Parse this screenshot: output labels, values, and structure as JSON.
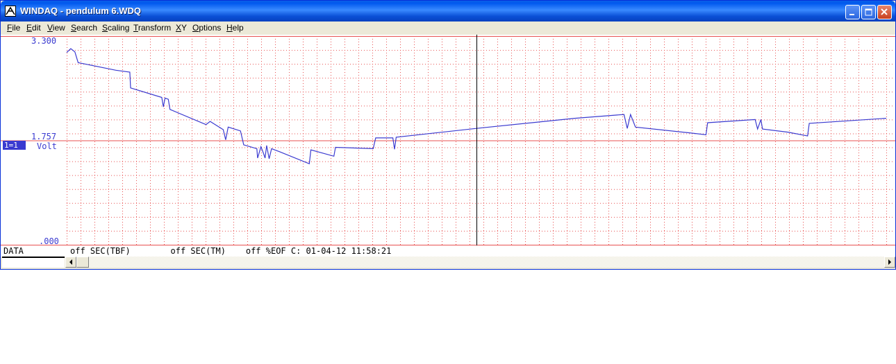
{
  "window": {
    "title": "WINDAQ - pendulum 6.WDQ"
  },
  "menu": {
    "items": [
      {
        "key": "F",
        "rest": "ile"
      },
      {
        "key": "E",
        "rest": "dit"
      },
      {
        "key": "V",
        "rest": "iew"
      },
      {
        "key": "S",
        "rest": "earch"
      },
      {
        "key": "S",
        "rest": "caling"
      },
      {
        "key": "T",
        "rest": "ransform"
      },
      {
        "key": "X",
        "rest": "Y"
      },
      {
        "key": "O",
        "rest": "ptions"
      },
      {
        "key": "H",
        "rest": "elp"
      }
    ]
  },
  "channel": {
    "badge": "1=1",
    "unit": "Volt",
    "top_value": "3.300",
    "mid_value": "1.757",
    "bottom_value": ".000"
  },
  "status": {
    "data_label": "DATA",
    "text": "off SEC(TBF)        off SEC(TM)    off %EOF C: 01-04-12 11:58:21"
  },
  "colors": {
    "grid": "#e85050",
    "trace": "#3a3ad0",
    "cursor": "#000000",
    "label": "#3a3ad0"
  },
  "chart_data": {
    "type": "line",
    "ylim": [
      0,
      3.3
    ],
    "ytick_labels": [
      "3.300",
      "1.757",
      ".000"
    ],
    "cursor_x": 0.5,
    "grid": true,
    "series": [
      {
        "points": [
          [
            0.0,
            3.04
          ],
          [
            0.005,
            3.1
          ],
          [
            0.01,
            3.05
          ],
          [
            0.014,
            2.88
          ],
          [
            0.06,
            2.76
          ],
          [
            0.077,
            2.73
          ],
          [
            0.078,
            2.48
          ],
          [
            0.116,
            2.33
          ],
          [
            0.118,
            2.18
          ],
          [
            0.12,
            2.32
          ],
          [
            0.124,
            2.3
          ],
          [
            0.126,
            2.14
          ],
          [
            0.17,
            1.9
          ],
          [
            0.175,
            1.95
          ],
          [
            0.191,
            1.82
          ],
          [
            0.194,
            1.66
          ],
          [
            0.197,
            1.86
          ],
          [
            0.212,
            1.8
          ],
          [
            0.216,
            1.58
          ],
          [
            0.232,
            1.52
          ],
          [
            0.233,
            1.37
          ],
          [
            0.237,
            1.55
          ],
          [
            0.24,
            1.45
          ],
          [
            0.242,
            1.37
          ],
          [
            0.244,
            1.57
          ],
          [
            0.247,
            1.36
          ],
          [
            0.25,
            1.52
          ],
          [
            0.26,
            1.47
          ],
          [
            0.296,
            1.28
          ],
          [
            0.298,
            1.5
          ],
          [
            0.326,
            1.4
          ],
          [
            0.328,
            1.54
          ],
          [
            0.374,
            1.52
          ],
          [
            0.377,
            1.69
          ],
          [
            0.398,
            1.69
          ],
          [
            0.4,
            1.51
          ],
          [
            0.402,
            1.7
          ],
          [
            0.5,
            1.84
          ],
          [
            0.62,
            2.0
          ],
          [
            0.68,
            2.06
          ],
          [
            0.684,
            1.84
          ],
          [
            0.688,
            2.06
          ],
          [
            0.694,
            1.86
          ],
          [
            0.76,
            1.77
          ],
          [
            0.78,
            1.74
          ],
          [
            0.782,
            1.93
          ],
          [
            0.84,
            1.98
          ],
          [
            0.843,
            1.83
          ],
          [
            0.847,
            1.98
          ],
          [
            0.849,
            1.83
          ],
          [
            0.88,
            1.78
          ],
          [
            0.904,
            1.72
          ],
          [
            0.906,
            1.92
          ],
          [
            1.0,
            2.0
          ]
        ]
      }
    ]
  }
}
